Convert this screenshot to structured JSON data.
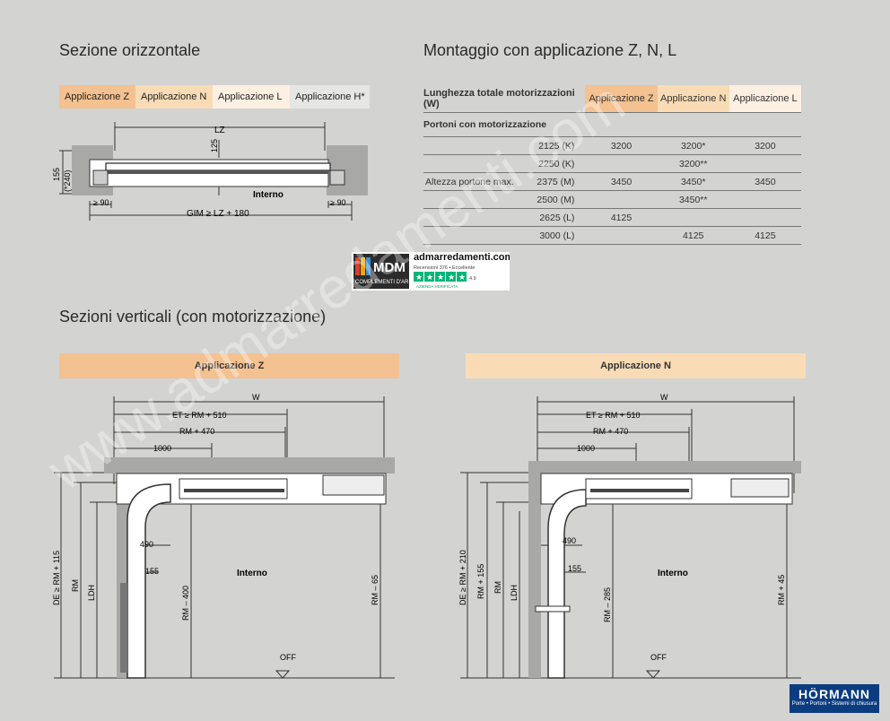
{
  "titles": {
    "horizontal": "Sezione orizzontale",
    "assembly": "Montaggio con applicazione Z, N, L",
    "vertical": "Sezioni verticali (con motorizzazione)"
  },
  "tabs": [
    "Applicazione Z",
    "Applicazione N",
    "Applicazione L",
    "Applicazione H*"
  ],
  "horizontal_section": {
    "lz": "LZ",
    "dim_125": "125",
    "dim_155": "155",
    "dim_240": "(*240)",
    "interior": "Interno",
    "left_90": "≥ 90",
    "right_90": "≥ 90",
    "gim": "GIM ≥ LZ + 180"
  },
  "table": {
    "col_label": "Lunghezza totale motorizzazioni (W)",
    "columns": [
      "Applicazione Z",
      "Applicazione N",
      "Applicazione L"
    ],
    "subheader": "Portoni con motorizzazione",
    "row_label": "Altezza portone max.",
    "rows": [
      {
        "w": "2125 (K)",
        "z": "3200",
        "n": "3200*",
        "l": "3200"
      },
      {
        "w": "2250 (K)",
        "z": "",
        "n": "3200**",
        "l": ""
      },
      {
        "w": "2375 (M)",
        "z": "3450",
        "n": "3450*",
        "l": "3450"
      },
      {
        "w": "2500 (M)",
        "z": "",
        "n": "3450**",
        "l": ""
      },
      {
        "w": "2625 (L)",
        "z": "4125",
        "n": "",
        "l": ""
      },
      {
        "w": "3000 (L)",
        "z": "",
        "n": "4125",
        "l": "4125"
      }
    ]
  },
  "mdm_logo": {
    "brand": "MDM",
    "tagline": "COMPLEMENTI D'ARREDO",
    "site": "admarredamenti.com",
    "reviews": "Recensioni 376 • Eccellente",
    "rating": "4.9",
    "verified": "AZIENDA VERIFICATA"
  },
  "vertical_z": {
    "banner": "Applicazione Z",
    "w": "W",
    "et": "ET ≥ RM + 510",
    "rm470": "RM + 470",
    "d1000": "1000",
    "d490": "490",
    "d155": "155",
    "interior": "Interno",
    "de": "DE ≥ RM + 115",
    "rm": "RM",
    "ldh": "LDH",
    "rm400": "RM – 400",
    "rm65": "RM – 65",
    "off": "OFF"
  },
  "vertical_n": {
    "banner": "Applicazione N",
    "w": "W",
    "et": "ET ≥ RM + 510",
    "rm470": "RM + 470",
    "d1000": "1000",
    "d490": "490",
    "d155": "155",
    "interior": "Interno",
    "de": "DE ≥ RM + 210",
    "rm155": "RM + 155",
    "rm": "RM",
    "ldh": "LDH",
    "rm285": "RM – 285",
    "rm45": "RM + 45",
    "off": "OFF"
  },
  "hormann": {
    "brand": "HÖRMANN",
    "tagline": "Porte • Portoni • Sistemi di chiusura"
  },
  "watermark": "www.admarredamenti.com"
}
